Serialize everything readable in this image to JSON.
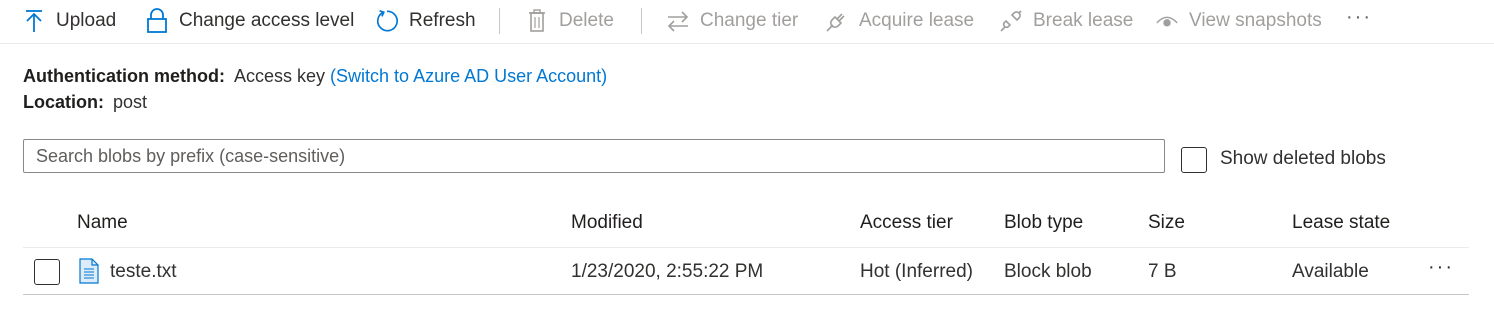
{
  "toolbar": {
    "upload": "Upload",
    "change_access_level": "Change access level",
    "refresh": "Refresh",
    "delete": "Delete",
    "change_tier": "Change tier",
    "acquire_lease": "Acquire lease",
    "break_lease": "Break lease",
    "view_snapshots": "View snapshots",
    "more": "···"
  },
  "info": {
    "auth_label": "Authentication method:",
    "auth_value": "Access key",
    "auth_link": "(Switch to Azure AD User Account)",
    "location_label": "Location:",
    "location_value": "post"
  },
  "search": {
    "placeholder": "Search blobs by prefix (case-sensitive)"
  },
  "show_deleted": {
    "label": "Show deleted blobs"
  },
  "table": {
    "columns": {
      "name": "Name",
      "modified": "Modified",
      "access_tier": "Access tier",
      "blob_type": "Blob type",
      "size": "Size",
      "lease_state": "Lease state"
    },
    "rows": [
      {
        "name": "teste.txt",
        "modified": "1/23/2020, 2:55:22 PM",
        "access_tier": "Hot (Inferred)",
        "blob_type": "Block blob",
        "size": "7 B",
        "lease_state": "Available",
        "more": "···"
      }
    ]
  },
  "colors": {
    "accent": "#0078d4",
    "text": "#323130",
    "disabled": "#a19f9d",
    "file_icon": "#0078d4"
  }
}
